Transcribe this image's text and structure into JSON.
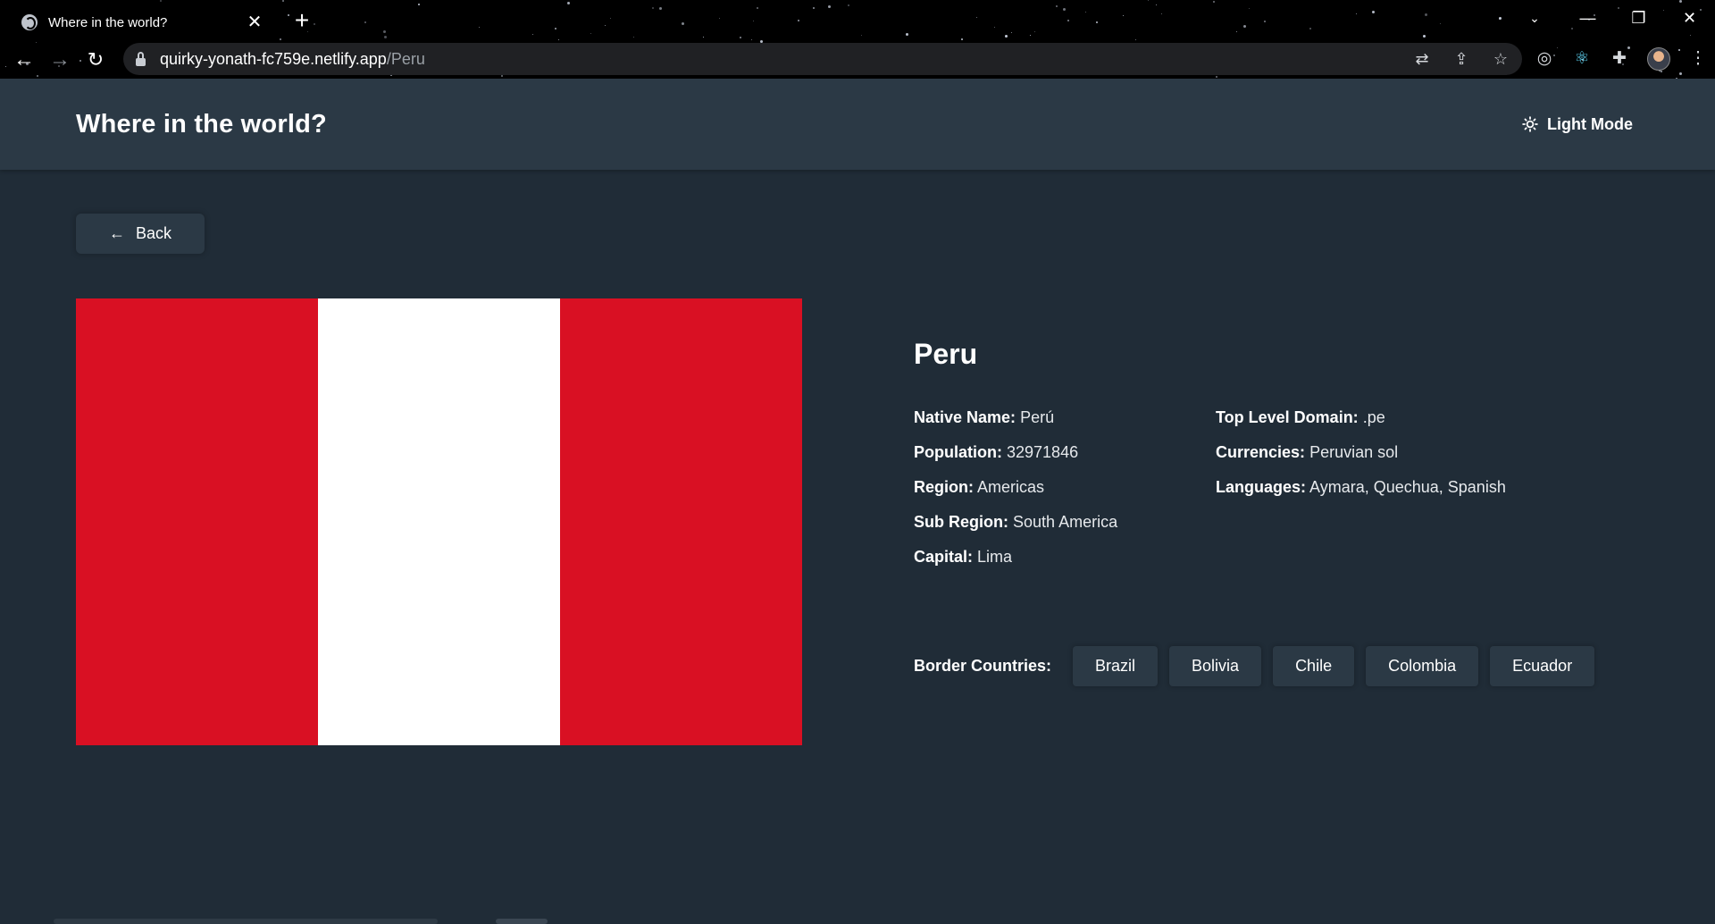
{
  "browser": {
    "tab_title": "Where in the world?",
    "tab_close": "✕",
    "new_tab": "+",
    "url_host": "quirky-yonath-fc759e.netlify.app",
    "url_path": "/Peru",
    "window": {
      "minimize": "—",
      "restore": "❐",
      "close": "✕"
    }
  },
  "header": {
    "title": "Where in the world?",
    "mode_label": "Light Mode",
    "mode_icon": "sun-icon"
  },
  "back_button": {
    "label": "Back",
    "icon": "arrow-left-icon"
  },
  "flag": {
    "colors": [
      "#D91023",
      "#FFFFFF",
      "#D91023"
    ]
  },
  "country": {
    "name": "Peru",
    "left": [
      {
        "label": "Native Name:",
        "value": "Perú"
      },
      {
        "label": "Population:",
        "value": "32971846"
      },
      {
        "label": "Region:",
        "value": "Americas"
      },
      {
        "label": "Sub Region:",
        "value": "South America"
      },
      {
        "label": "Capital:",
        "value": "Lima"
      }
    ],
    "right": [
      {
        "label": "Top Level Domain:",
        "value": ".pe"
      },
      {
        "label": "Currencies:",
        "value": "Peruvian sol"
      },
      {
        "label": "Languages:",
        "value": "Aymara, Quechua, Spanish"
      }
    ],
    "border_label": "Border Countries:",
    "borders": [
      "Brazil",
      "Bolivia",
      "Chile",
      "Colombia",
      "Ecuador"
    ]
  },
  "theme": {
    "background": "#202c37",
    "elements": "#2b3945",
    "text": "#ffffff"
  }
}
